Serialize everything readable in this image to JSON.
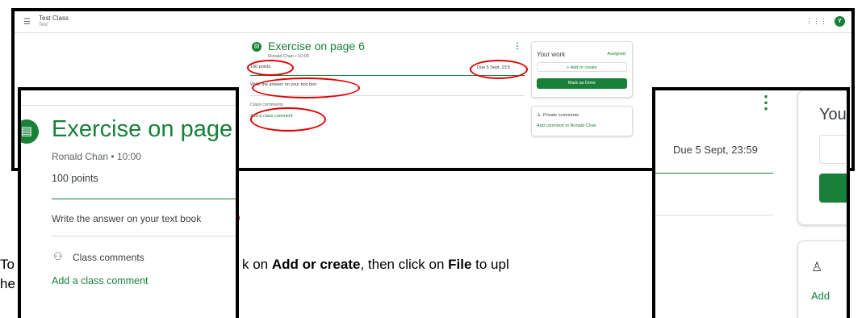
{
  "classroom": {
    "class_name": "Test Class",
    "class_section": "Test",
    "avatar_letter": "Y",
    "assignment": {
      "title": "Exercise on page 6",
      "author_time": "Ronald Chan • 10:00",
      "points": "100 points",
      "due": "Due 5 Sept, 23:59",
      "due_cropped": "Due 5 Sept, 23:5",
      "description": "Write the answer on your text book",
      "description_cropped": "Write the answer on your text boo",
      "class_comments_label": "Class comments",
      "add_class_comment": "Add a class comment"
    },
    "your_work": {
      "title": "Your work",
      "title_cropped": "You",
      "status": "Assigned",
      "add_or_create": "+  Add or create",
      "mark_as_done": "Mark as Done"
    },
    "private_comments": {
      "title": "Private comments",
      "add": "Add comment to Ronald Chan",
      "add_cropped": "Add"
    },
    "zoom_left": {
      "title_cropped": "Exercise on page"
    }
  },
  "instruction": {
    "line1_start": "To",
    "line1_mid_pre": "k on ",
    "bold1": "Add or create",
    "mid": ", then click on ",
    "bold2": "File",
    "end": " to upl",
    "line2_start": "he"
  },
  "colors": {
    "accent_green": "#188038",
    "annotation_red": "#e00000",
    "frame": "#000000"
  },
  "icons": {
    "menu": "hamburger-icon",
    "apps": "apps-grid-icon",
    "assignment": "assignment-icon",
    "more": "more-vert-icon",
    "people": "people-icon",
    "person": "person-icon"
  }
}
